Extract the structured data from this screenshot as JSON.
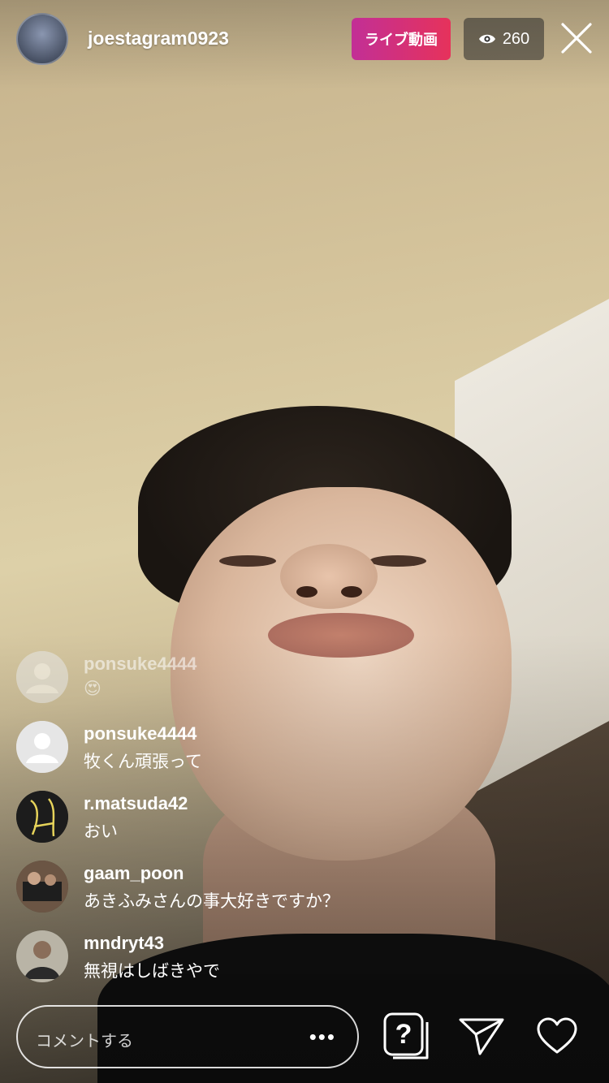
{
  "header": {
    "host_username": "joestagram0923",
    "live_label": "ライブ動画",
    "viewer_count": "260",
    "live_badge_color": "#d8307a"
  },
  "comments": [
    {
      "username": "ponsuke4444",
      "text": "😍",
      "faded": true,
      "avatar": "default-person-icon"
    },
    {
      "username": "ponsuke4444",
      "text": "牧くん頑張って",
      "faded": false,
      "avatar": "default-person-icon"
    },
    {
      "username": "r.matsuda42",
      "text": "おい",
      "faded": false,
      "avatar": "yellow-line-art-avatar"
    },
    {
      "username": "gaam_poon",
      "text": "あきふみさんの事大好きですか？",
      "faded": false,
      "avatar": "photo-avatar"
    },
    {
      "username": "mndryt43",
      "text": "無視はしばきやで",
      "faded": false,
      "avatar": "photo-avatar"
    }
  ],
  "footer": {
    "comment_placeholder": "コメントする",
    "more_label": "•••",
    "icons": [
      "question-sticker-icon",
      "send-icon",
      "heart-icon"
    ]
  }
}
